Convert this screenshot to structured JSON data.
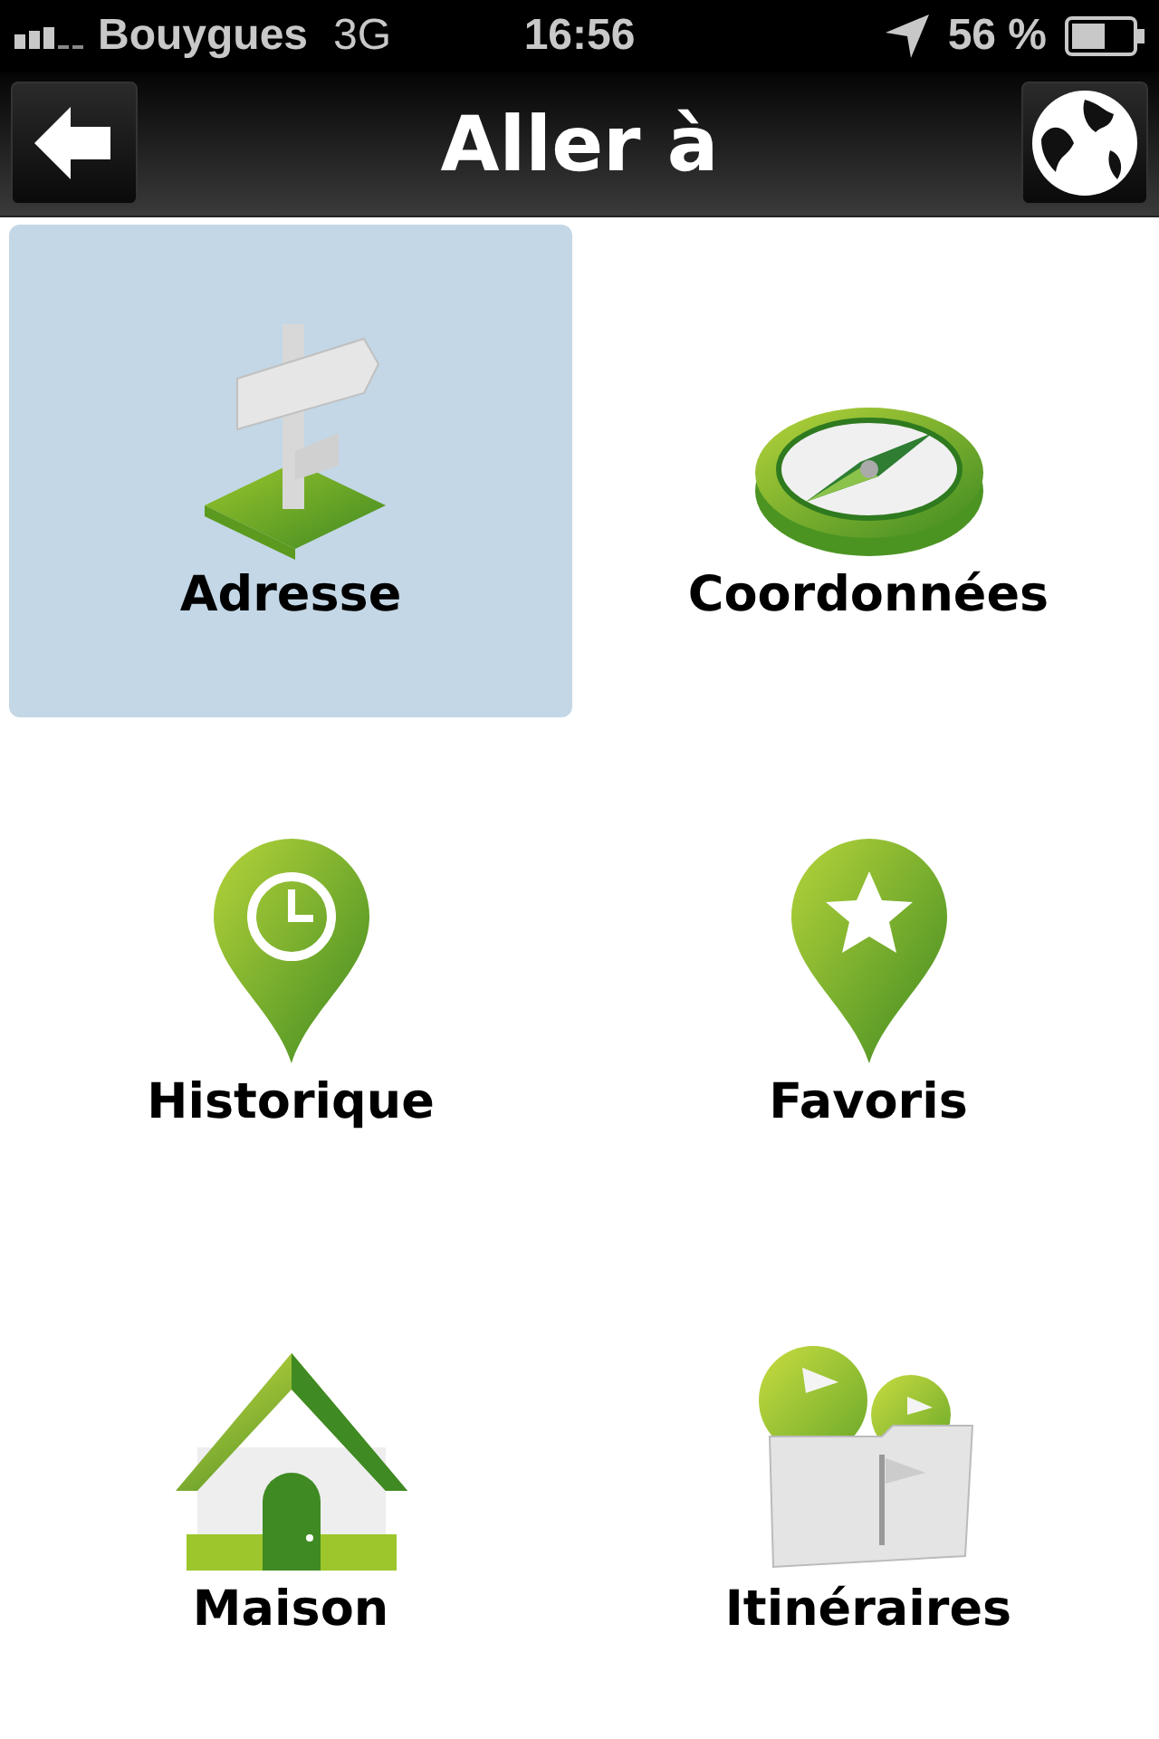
{
  "status_bar": {
    "carrier": "Bouygues",
    "network": "3G",
    "time": "16:56",
    "battery": "56 %"
  },
  "nav_bar": {
    "title": "Aller à"
  },
  "items": [
    {
      "kind": "signpost",
      "label": "Adresse",
      "selected": true
    },
    {
      "kind": "compass",
      "label": "Coordonnées",
      "selected": false
    },
    {
      "kind": "history",
      "label": "Historique",
      "selected": false
    },
    {
      "kind": "favorite",
      "label": "Favoris",
      "selected": false
    },
    {
      "kind": "home",
      "label": "Maison",
      "selected": false
    },
    {
      "kind": "routes",
      "label": "Itinéraires",
      "selected": false
    }
  ]
}
